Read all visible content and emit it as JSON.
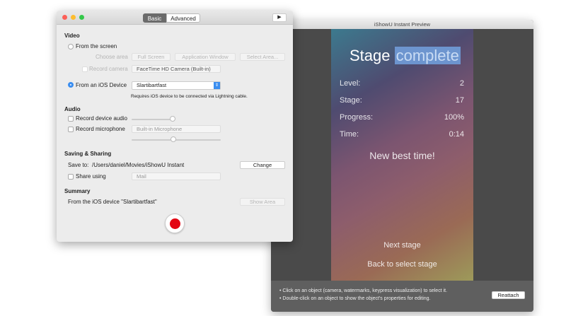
{
  "main_window": {
    "tabs": [
      "Basic",
      "Advanced"
    ],
    "video": {
      "heading": "Video",
      "from_screen": "From the screen",
      "choose_area": "Choose area",
      "area_buttons": [
        "Full Screen",
        "Application Window",
        "Select Area..."
      ],
      "record_camera": "Record camera",
      "camera_value": "FaceTime HD Camera (Built-in)",
      "from_ios": "From an iOS Device",
      "ios_value": "Slartibartfast",
      "ios_note": "Requires iOS device to be connected via Lightning cable."
    },
    "audio": {
      "heading": "Audio",
      "device_audio": "Record device audio",
      "microphone": "Record microphone",
      "mic_value": "Built-in Microphone"
    },
    "saving": {
      "heading": "Saving & Sharing",
      "save_to_label": "Save to:",
      "save_path": "/Users/daniel/Movies/iShowU Instant",
      "change": "Change",
      "share_using": "Share using",
      "share_value": "Mail"
    },
    "summary": {
      "heading": "Summary",
      "text": "From the iOS device \"Slartibartfast\"",
      "show_area": "Show Area"
    }
  },
  "preview_window": {
    "title": "iShowU Instant Preview",
    "game": {
      "title_a": "Stage",
      "title_b": "complete",
      "rows": [
        {
          "label": "Level:",
          "value": "2"
        },
        {
          "label": "Stage:",
          "value": "17"
        },
        {
          "label": "Progress:",
          "value": "100%"
        },
        {
          "label": "Time:",
          "value": "0:14"
        }
      ],
      "best": "New best time!",
      "next": "Next stage",
      "back": "Back to select stage"
    },
    "hints": [
      "• Click on an object (camera, watermarks, keypress visualization) to select it.",
      "• Double-click on an object to show the object's properties for editing."
    ],
    "reattach": "Reattach"
  },
  "colors": {
    "record": "#e30613",
    "accent": "#3b8ef0"
  }
}
